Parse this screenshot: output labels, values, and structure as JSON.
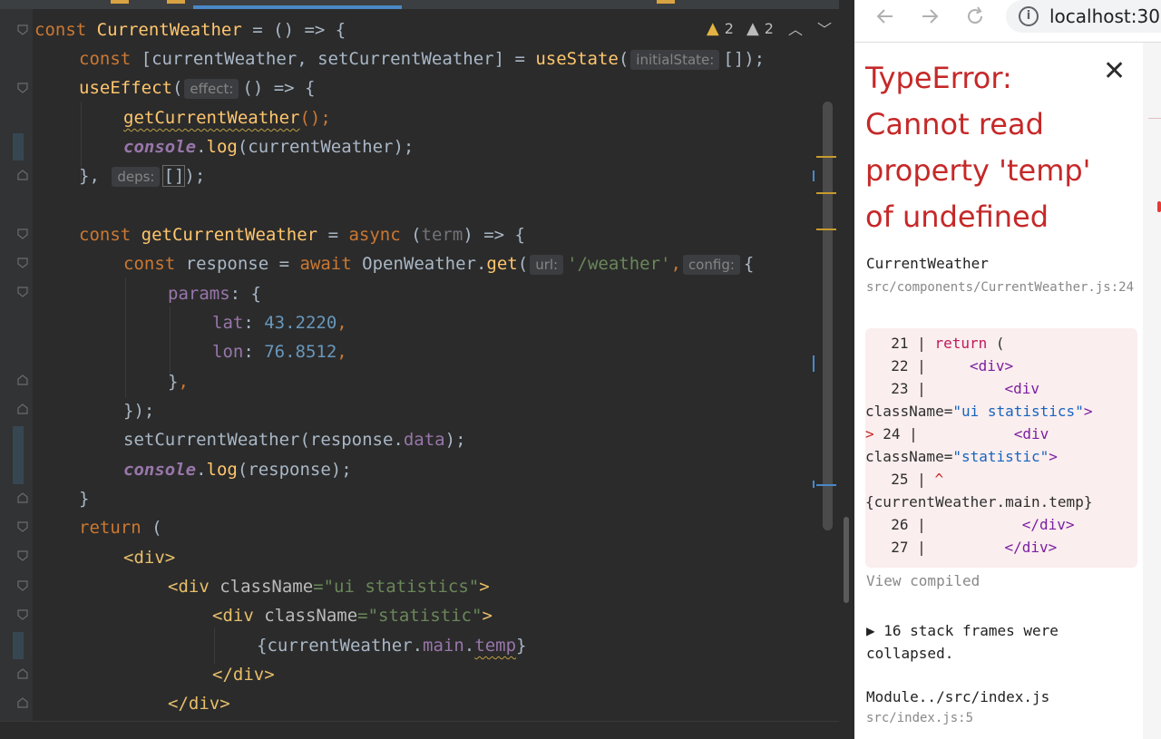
{
  "editor": {
    "warnings": {
      "a": "2",
      "b": "2"
    },
    "lines": [
      {
        "code": "const CurrentWeather = () => {"
      },
      {
        "code": "const [currentWeather, setCurrentWeather] = useState(initialState: []);"
      },
      {
        "code": "useEffect(effect: () => {"
      },
      {
        "code": "getCurrentWeather();"
      },
      {
        "code": "console.log(currentWeather);"
      },
      {
        "code": "}, deps: []);"
      },
      {
        "code": ""
      },
      {
        "code": "const getCurrentWeather = async (term) => {"
      },
      {
        "code": "const response = await OpenWeather.get(url: '/weather', config: {"
      },
      {
        "code": "params: {"
      },
      {
        "code": "lat: 43.2220,"
      },
      {
        "code": "lon: 76.8512,"
      },
      {
        "code": "},"
      },
      {
        "code": "});"
      },
      {
        "code": "setCurrentWeather(response.data);"
      },
      {
        "code": "console.log(response);"
      },
      {
        "code": "}"
      },
      {
        "code": "return ("
      },
      {
        "code": "<div>"
      },
      {
        "code": "<div className=\"ui statistics\">"
      },
      {
        "code": "<div className=\"statistic\">"
      },
      {
        "code": "{currentWeather.main.temp}"
      },
      {
        "code": "</div>"
      },
      {
        "code": "</div>"
      }
    ],
    "tokens": {
      "kw_const": "const",
      "name_component": "CurrentWeather",
      "arrow_open": " = () => {",
      "l2_destructure": " [currentWeather, setCurrentWeather] = ",
      "use_state": "useState",
      "paren_open": "(",
      "hint_initial": "initialState:",
      "l2_tail": "[]);",
      "use_effect": "useEffect",
      "hint_effect": "effect:",
      "l3_tail": "() => {",
      "get_current": "getCurrentWeather",
      "call_end": "();",
      "console": "console",
      "dot_log": ".",
      "log": "log",
      "l5_arg": "(currentWeather);",
      "l6_head": "},",
      "hint_deps": "deps:",
      "l6_bracket": "[]",
      "l6_tail": ");",
      "l8_eq": " = ",
      "async": "async",
      "l8_term_open": " (",
      "term": "term",
      "l8_tail": ") => {",
      "response_decl": " response = ",
      "await": "await",
      "openweather": " OpenWeather.",
      "get": "get",
      "hint_url": "url:",
      "url_str": "'/weather'",
      "comma": ",",
      "hint_config": "config:",
      "brace": "{",
      "params": "params",
      "colon_brace": ": {",
      "lat": "lat",
      "colon_sp": ": ",
      "lat_val": "43.2220",
      "lon": "lon",
      "lon_val": "76.8512",
      "close_brace": "}",
      "close_all": "});",
      "set_current": "setCurrentWeather(response.",
      "data": "data",
      "paren_close_semi": ");",
      "l16_arg": "(response);",
      "close_fn": "}",
      "return": "return",
      "return_paren": " (",
      "div_open": "<div>",
      "div_lt": "<div ",
      "class_attr": "className",
      "eq": "=",
      "cls_stats": "\"ui statistics\"",
      "cls_stat": "\"statistic\"",
      "gt": ">",
      "expr_open": "{currentWeather.",
      "main": "main",
      "dot": ".",
      "temp": "temp",
      "expr_close": "}",
      "div_close": "</div>"
    }
  },
  "browser": {
    "back_icon": "arrow-left-icon",
    "forward_icon": "arrow-right-icon",
    "reload_icon": "reload-icon",
    "url": "localhost:30",
    "error_title": "TypeError: Cannot read property 'temp' of undefined",
    "component": "CurrentWeather",
    "component_location": "src/components/CurrentWeather.js:24",
    "code_frame": {
      "l21_no": "  21 | ",
      "l21_code": "return",
      "l21_tail": " (",
      "l22_no": "  22 | ",
      "l22_code": "    <div>",
      "l23_no": "  23 | ",
      "l23_code": "        <div",
      "l23b_attr": "className=",
      "l23b_val": "\"ui statistics\"",
      "l23b_gt": ">",
      "l24_arrow": "> ",
      "l24_no": "24 | ",
      "l24_code": "          <div",
      "l24b_attr": "className=",
      "l24b_val": "\"statistic\"",
      "l24b_gt": ">",
      "l25_no": "  25 | ",
      "l25_caret": "^",
      "l25b_code": "{currentWeather.main.temp}",
      "l26_no": "  26 | ",
      "l26_code": "          </div>",
      "l27_no": "  27 | ",
      "l27_code": "        </div>"
    },
    "view_compiled": "View compiled",
    "stack_frames": "▶ 16 stack frames were collapsed.",
    "module": "Module../src/index.js",
    "module_location": "src/index.js:5"
  }
}
